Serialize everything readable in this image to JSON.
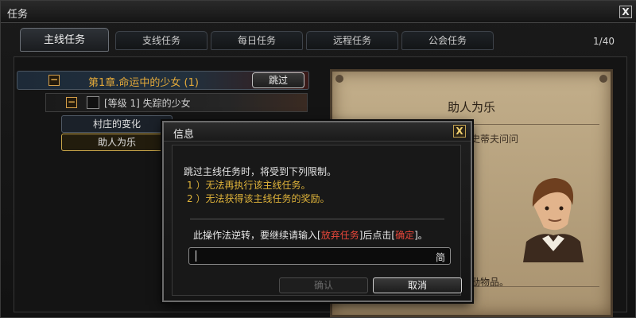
{
  "window": {
    "title": "任务",
    "close_glyph": "X",
    "page_indicator": "1/40"
  },
  "tabs": [
    {
      "label": "主线任务",
      "active": true
    },
    {
      "label": "支线任务",
      "active": false
    },
    {
      "label": "每日任务",
      "active": false
    },
    {
      "label": "远程任务",
      "active": false
    },
    {
      "label": "公会任务",
      "active": false
    }
  ],
  "tree": {
    "chapter": {
      "toggle": "−",
      "label": "第1章.命运中的少女 (1)",
      "skip_label": "跳过"
    },
    "quest": {
      "toggle": "−",
      "label": "[等级 1] 失踪的少女"
    },
    "sub_items": [
      {
        "label": "村庄的变化",
        "selected": false
      },
      {
        "label": "助人为乐",
        "selected": true
      }
    ]
  },
  "detail": {
    "title": "助人为乐",
    "description": "我们需要村民的帮助，去找卫兵史蒂夫问问",
    "reward_text": "奖励物品。"
  },
  "dialog": {
    "title": "信息",
    "close_glyph": "X",
    "line1": "跳过主线任务时，将受到下列限制。",
    "line2": "1 ）无法再执行该主线任务。",
    "line3": "2 ）无法获得该主线任务的奖励。",
    "instr_pre": "此操作法逆转，要继续请输入[",
    "instr_key1": "放弃任务",
    "instr_mid": "]后点击[",
    "instr_key2": "确定",
    "instr_post": "]。",
    "input_value": "",
    "ime_indicator": "简",
    "confirm_label": "确认",
    "cancel_label": "取消"
  },
  "colors": {
    "chapter_gold": "#e3a93a",
    "warning_yellow": "#e0b43a",
    "keyword_red": "#e8473a"
  }
}
